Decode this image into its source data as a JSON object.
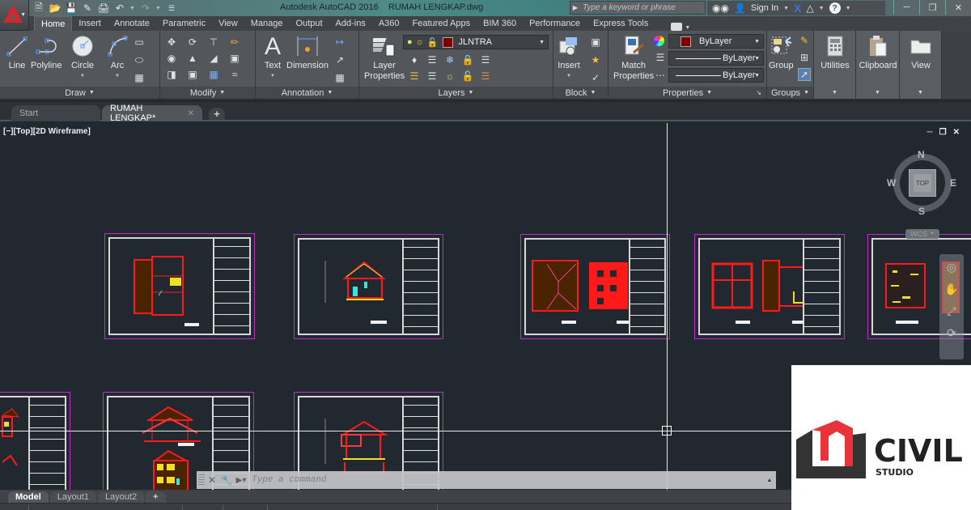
{
  "app": {
    "title": "Autodesk AutoCAD 2016    RUMAH LENGKAP.dwg",
    "search_placeholder": "Type a keyword or phrase",
    "sign_in": "Sign In"
  },
  "quick_access": [
    "new-icon",
    "open-icon",
    "save-icon",
    "save-as-icon",
    "print-icon",
    "undo-icon",
    "redo-icon",
    "customize-icon"
  ],
  "ribbon_tabs": [
    {
      "label": "Home",
      "active": true
    },
    {
      "label": "Insert"
    },
    {
      "label": "Annotate"
    },
    {
      "label": "Parametric"
    },
    {
      "label": "View"
    },
    {
      "label": "Manage"
    },
    {
      "label": "Output"
    },
    {
      "label": "Add-ins"
    },
    {
      "label": "A360"
    },
    {
      "label": "Featured Apps"
    },
    {
      "label": "BIM 360"
    },
    {
      "label": "Performance"
    },
    {
      "label": "Express Tools"
    }
  ],
  "panels": {
    "draw": {
      "title": "Draw",
      "buttons": [
        "Line",
        "Polyline",
        "Circle",
        "Arc"
      ]
    },
    "modify": {
      "title": "Modify"
    },
    "annotation": {
      "title": "Annotation",
      "buttons": [
        "Text",
        "Dimension"
      ]
    },
    "layers": {
      "title": "Layers",
      "layer_properties_line1": "Layer",
      "layer_properties_line2": "Properties",
      "current_layer": "JLNTRA",
      "layer_color": "#7a0000"
    },
    "block": {
      "title": "Block",
      "insert": "Insert"
    },
    "properties": {
      "title": "Properties",
      "match_line1": "Match",
      "match_line2": "Properties",
      "color": "ByLayer",
      "linetype": "ByLayer",
      "lineweight": "ByLayer",
      "color_swatch": "#7a0000"
    },
    "groups": {
      "title": "Groups",
      "group": "Group"
    },
    "utilities": {
      "title": "Utilities"
    },
    "clipboard": {
      "title": "Clipboard"
    },
    "view": {
      "title": "View"
    }
  },
  "doc_tabs": [
    {
      "label": "Start"
    },
    {
      "label": "RUMAH LENGKAP*",
      "active": true
    }
  ],
  "viewport": {
    "label": "[−][Top][2D Wireframe]",
    "viewcube": {
      "face": "TOP",
      "n": "N",
      "s": "S",
      "e": "E",
      "w": "W",
      "ucs": "WCS"
    }
  },
  "command_line": {
    "placeholder": "Type a command"
  },
  "layout_tabs": [
    {
      "label": "Model",
      "active": true
    },
    {
      "label": "Layout1"
    },
    {
      "label": "Layout2"
    }
  ],
  "overlay_logo": {
    "word1": "CIVIL",
    "word2": "STUDIO",
    "accent": "#e8333a",
    "dark": "#333333"
  },
  "colors": {
    "canvas": "#212830",
    "sheet_border": "#c22cc6",
    "wall_red": "#ff1a1a",
    "roof_brown": "#4a2300"
  }
}
